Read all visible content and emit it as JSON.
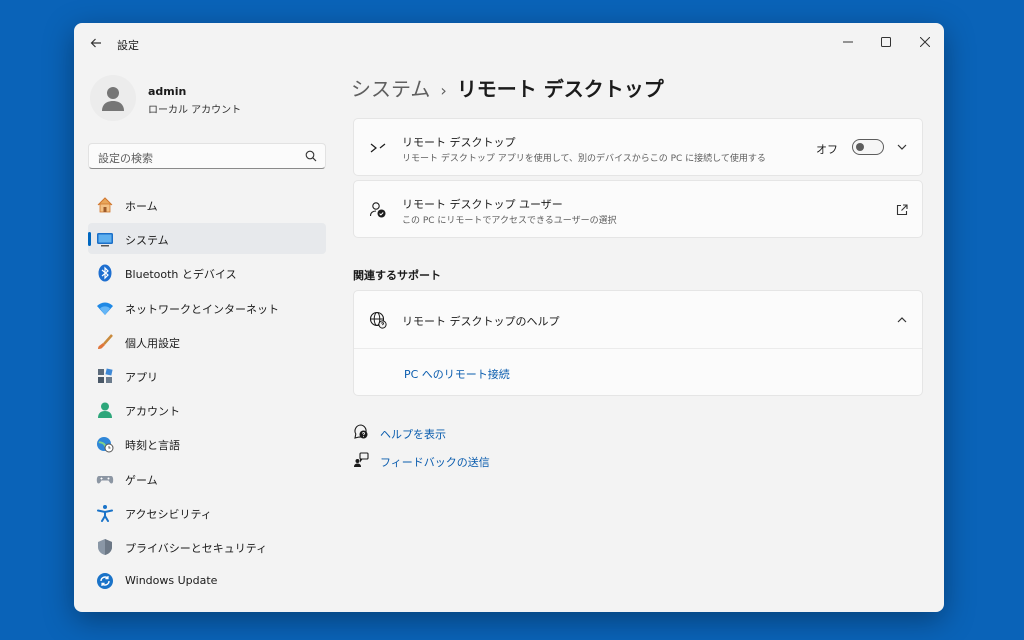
{
  "window": {
    "app_title": "設定",
    "controls": {
      "minimize": "minimize-icon",
      "maximize": "maximize-icon",
      "close": "close-icon"
    }
  },
  "profile": {
    "name": "admin",
    "account_type": "ローカル アカウント"
  },
  "search": {
    "placeholder": "設定の検索"
  },
  "sidebar": {
    "items": [
      {
        "label": "ホーム",
        "icon": "home-icon"
      },
      {
        "label": "システム",
        "icon": "system-icon",
        "active": true
      },
      {
        "label": "Bluetooth とデバイス",
        "icon": "bluetooth-icon"
      },
      {
        "label": "ネットワークとインターネット",
        "icon": "network-icon"
      },
      {
        "label": "個人用設定",
        "icon": "brush-icon"
      },
      {
        "label": "アプリ",
        "icon": "apps-icon"
      },
      {
        "label": "アカウント",
        "icon": "account-icon"
      },
      {
        "label": "時刻と言語",
        "icon": "time-language-icon"
      },
      {
        "label": "ゲーム",
        "icon": "gaming-icon"
      },
      {
        "label": "アクセシビリティ",
        "icon": "accessibility-icon"
      },
      {
        "label": "プライバシーとセキュリティ",
        "icon": "shield-icon"
      },
      {
        "label": "Windows Update",
        "icon": "windows-update-icon"
      }
    ]
  },
  "breadcrumb": {
    "parent": "システム",
    "separator": "›",
    "current": "リモート デスクトップ"
  },
  "remote_desktop": {
    "title": "リモート デスクトップ",
    "description": "リモート デスクトップ アプリを使用して、別のデバイスからこの PC に接続して使用する",
    "toggle_label": "オフ",
    "toggle_on": false
  },
  "remote_users": {
    "title": "リモート デスクトップ ユーザー",
    "description": "この PC にリモートでアクセスできるユーザーの選択"
  },
  "support": {
    "section_title": "関連するサポート",
    "help_title": "リモート デスクトップのヘルプ",
    "link": "PC へのリモート接続"
  },
  "footer": {
    "help": "ヘルプを表示",
    "feedback": "フィードバックの送信"
  },
  "colors": {
    "accent": "#0067c0",
    "desktop": "#0a63b8",
    "link": "#0a5cae"
  }
}
